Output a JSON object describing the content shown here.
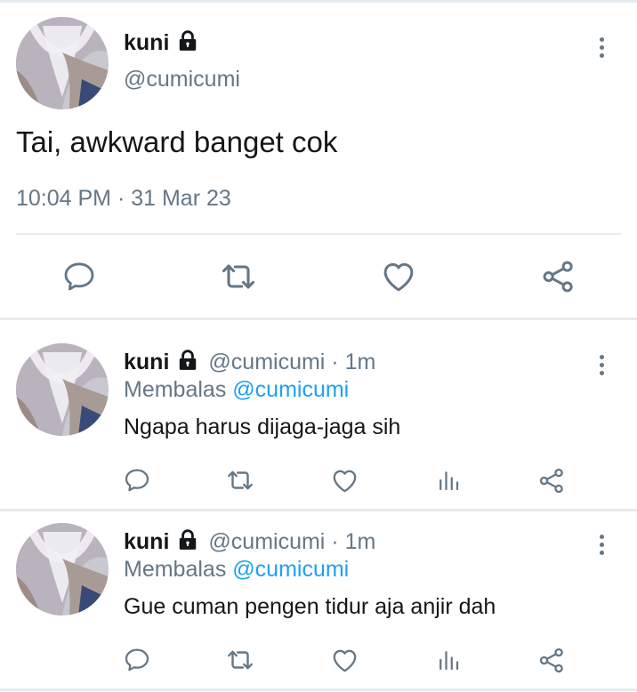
{
  "main_tweet": {
    "name": "kuni",
    "handle": "@cumicumi",
    "text": "Tai, awkward banget cok",
    "timestamp": "10:04 PM · 31 Mar 23",
    "actions": [
      "reply-icon",
      "retweet-icon",
      "like-icon",
      "share-icon"
    ]
  },
  "replies": [
    {
      "name": "kuni",
      "handle_time": "@cumicumi · 1m",
      "replying_label": "Membalas",
      "replying_to": "@cumicumi",
      "text": "Ngapa harus dijaga-jaga sih",
      "actions": [
        "reply-icon",
        "retweet-icon",
        "like-icon",
        "analytics-icon",
        "share-icon"
      ]
    },
    {
      "name": "kuni",
      "handle_time": "@cumicumi · 1m",
      "replying_label": "Membalas",
      "replying_to": "@cumicumi",
      "text": "Gue cuman pengen tidur aja anjir dah",
      "actions": [
        "reply-icon",
        "retweet-icon",
        "like-icon",
        "analytics-icon",
        "share-icon"
      ]
    }
  ],
  "colors": {
    "text": "#14171a",
    "secondary": "#657786",
    "link": "#1da1f2",
    "divider": "#e6ecf0"
  }
}
